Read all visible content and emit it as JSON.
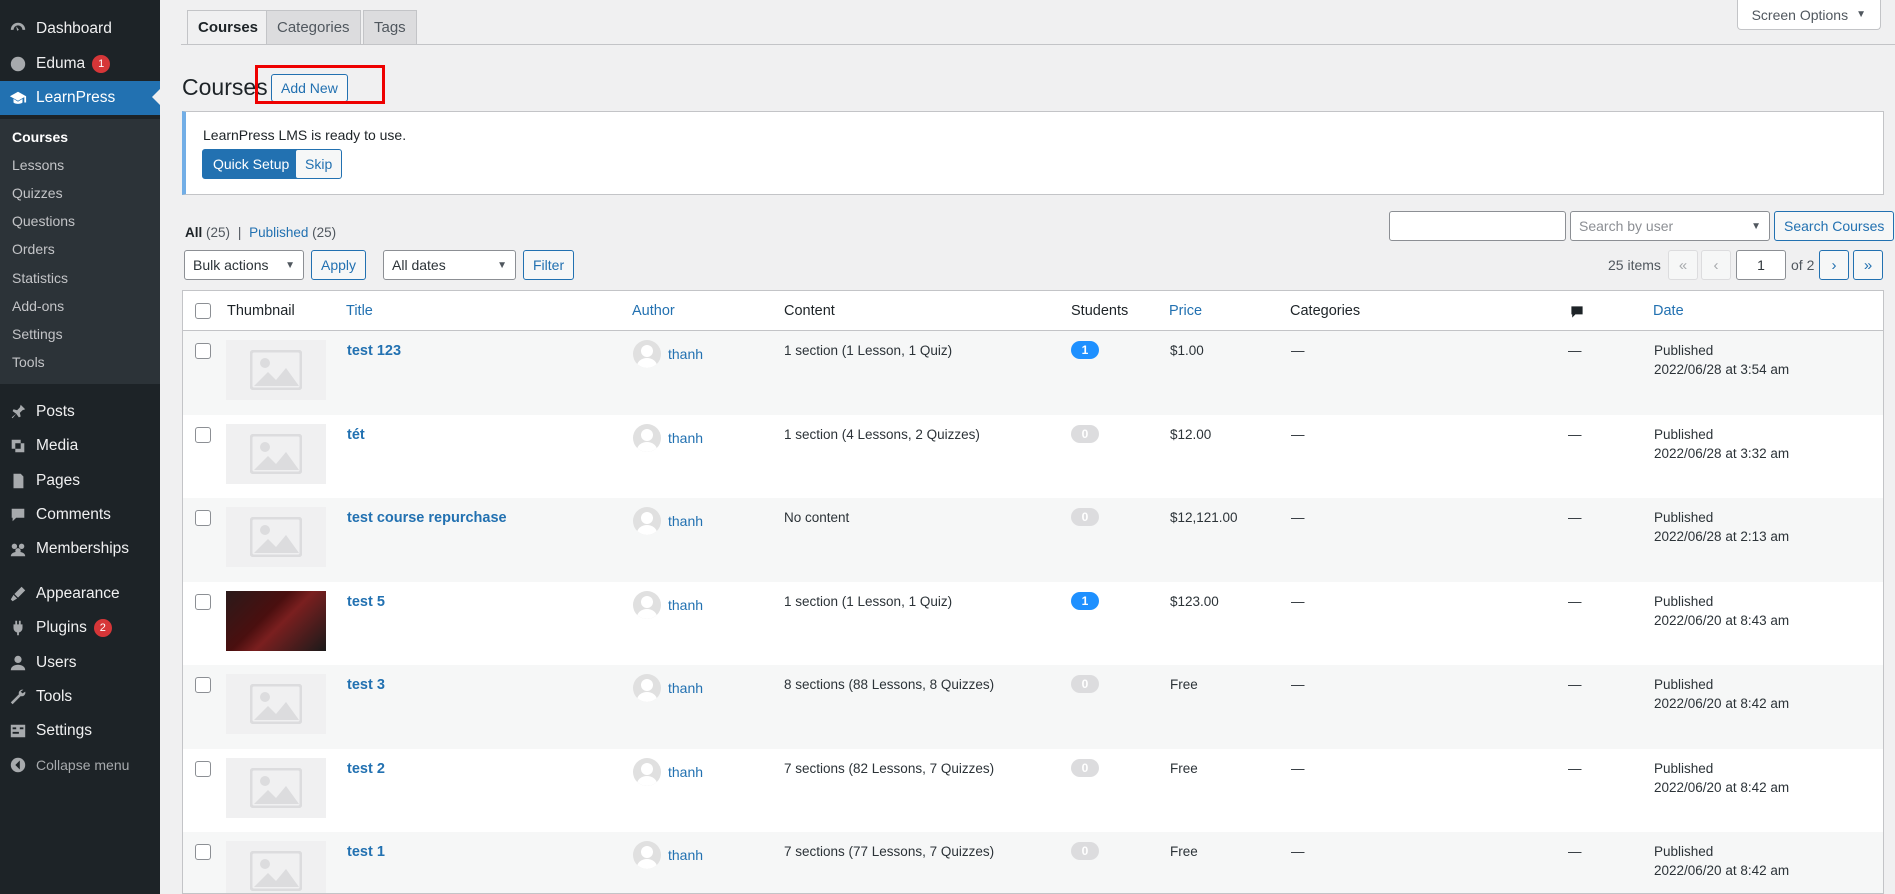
{
  "sidebar": {
    "items": [
      {
        "label": "Dashboard",
        "icon": "dashboard-icon"
      },
      {
        "label": "Eduma",
        "icon": "eduma-icon",
        "badge": "1"
      },
      {
        "label": "LearnPress",
        "icon": "learnpress-icon"
      },
      {
        "label": "Posts",
        "icon": "pin-icon"
      },
      {
        "label": "Media",
        "icon": "media-icon"
      },
      {
        "label": "Pages",
        "icon": "pages-icon"
      },
      {
        "label": "Comments",
        "icon": "comments-icon"
      },
      {
        "label": "Memberships",
        "icon": "memberships-icon"
      },
      {
        "label": "Appearance",
        "icon": "appearance-icon"
      },
      {
        "label": "Plugins",
        "icon": "plugins-icon",
        "badge": "2"
      },
      {
        "label": "Users",
        "icon": "users-icon"
      },
      {
        "label": "Tools",
        "icon": "tools-icon"
      },
      {
        "label": "Settings",
        "icon": "settings-icon"
      },
      {
        "label": "Collapse menu",
        "icon": "collapse-icon"
      }
    ],
    "submenu": [
      "Courses",
      "Lessons",
      "Quizzes",
      "Questions",
      "Orders",
      "Statistics",
      "Add-ons",
      "Settings",
      "Tools"
    ]
  },
  "tabs": [
    "Courses",
    "Categories",
    "Tags"
  ],
  "screen_options": "Screen Options",
  "page_title": "Courses",
  "add_new": "Add New",
  "notice": {
    "text": "LearnPress LMS is ready to use.",
    "quick_setup": "Quick Setup",
    "skip": "Skip"
  },
  "filters": {
    "all_label": "All",
    "all_count": "(25)",
    "published_label": "Published",
    "published_count": "(25)",
    "bulk_actions": "Bulk actions",
    "apply": "Apply",
    "all_dates": "All dates",
    "filter": "Filter",
    "search_value": "",
    "search_by_user_placeholder": "Search by user",
    "search_courses": "Search Courses",
    "items_count": "25 items",
    "current_page": "1",
    "of_pages": "of 2",
    "first": "«",
    "prev": "‹",
    "next": "›",
    "last": "»"
  },
  "table": {
    "headers": {
      "thumbnail": "Thumbnail",
      "title": "Title",
      "author": "Author",
      "content": "Content",
      "students": "Students",
      "price": "Price",
      "categories": "Categories",
      "comments_icon": "comment-icon",
      "date": "Date"
    },
    "rows": [
      {
        "title": "test 123",
        "author": "thanh",
        "content": "1 section (1 Lesson, 1 Quiz)",
        "students": "1",
        "students_active": true,
        "price": "$1.00",
        "categories": "—",
        "comments": "—",
        "status": "Published",
        "date": "2022/06/28 at 3:54 am",
        "thumb": "placeholder"
      },
      {
        "title": "tét",
        "author": "thanh",
        "content": "1 section (4 Lessons, 2 Quizzes)",
        "students": "0",
        "students_active": false,
        "price": "$12.00",
        "categories": "—",
        "comments": "—",
        "status": "Published",
        "date": "2022/06/28 at 3:32 am",
        "thumb": "placeholder"
      },
      {
        "title": "test course repurchase",
        "author": "thanh",
        "content": "No content",
        "students": "0",
        "students_active": false,
        "price": "$12,121.00",
        "categories": "—",
        "comments": "—",
        "status": "Published",
        "date": "2022/06/28 at 2:13 am",
        "thumb": "placeholder"
      },
      {
        "title": "test 5",
        "author": "thanh",
        "content": "1 section (1 Lesson, 1 Quiz)",
        "students": "1",
        "students_active": true,
        "price": "$123.00",
        "categories": "—",
        "comments": "—",
        "status": "Published",
        "date": "2022/06/20 at 8:43 am",
        "thumb": "photo"
      },
      {
        "title": "test 3",
        "author": "thanh",
        "content": "8 sections (88 Lessons, 8 Quizzes)",
        "students": "0",
        "students_active": false,
        "price": "Free",
        "categories": "—",
        "comments": "—",
        "status": "Published",
        "date": "2022/06/20 at 8:42 am",
        "thumb": "placeholder"
      },
      {
        "title": "test 2",
        "author": "thanh",
        "content": "7 sections (82 Lessons, 7 Quizzes)",
        "students": "0",
        "students_active": false,
        "price": "Free",
        "categories": "—",
        "comments": "—",
        "status": "Published",
        "date": "2022/06/20 at 8:42 am",
        "thumb": "placeholder"
      },
      {
        "title": "test 1",
        "author": "thanh",
        "content": "7 sections (77 Lessons, 7 Quizzes)",
        "students": "0",
        "students_active": false,
        "price": "Free",
        "categories": "—",
        "comments": "—",
        "status": "Published",
        "date": "2022/06/20 at 8:42 am",
        "thumb": "placeholder"
      }
    ]
  }
}
